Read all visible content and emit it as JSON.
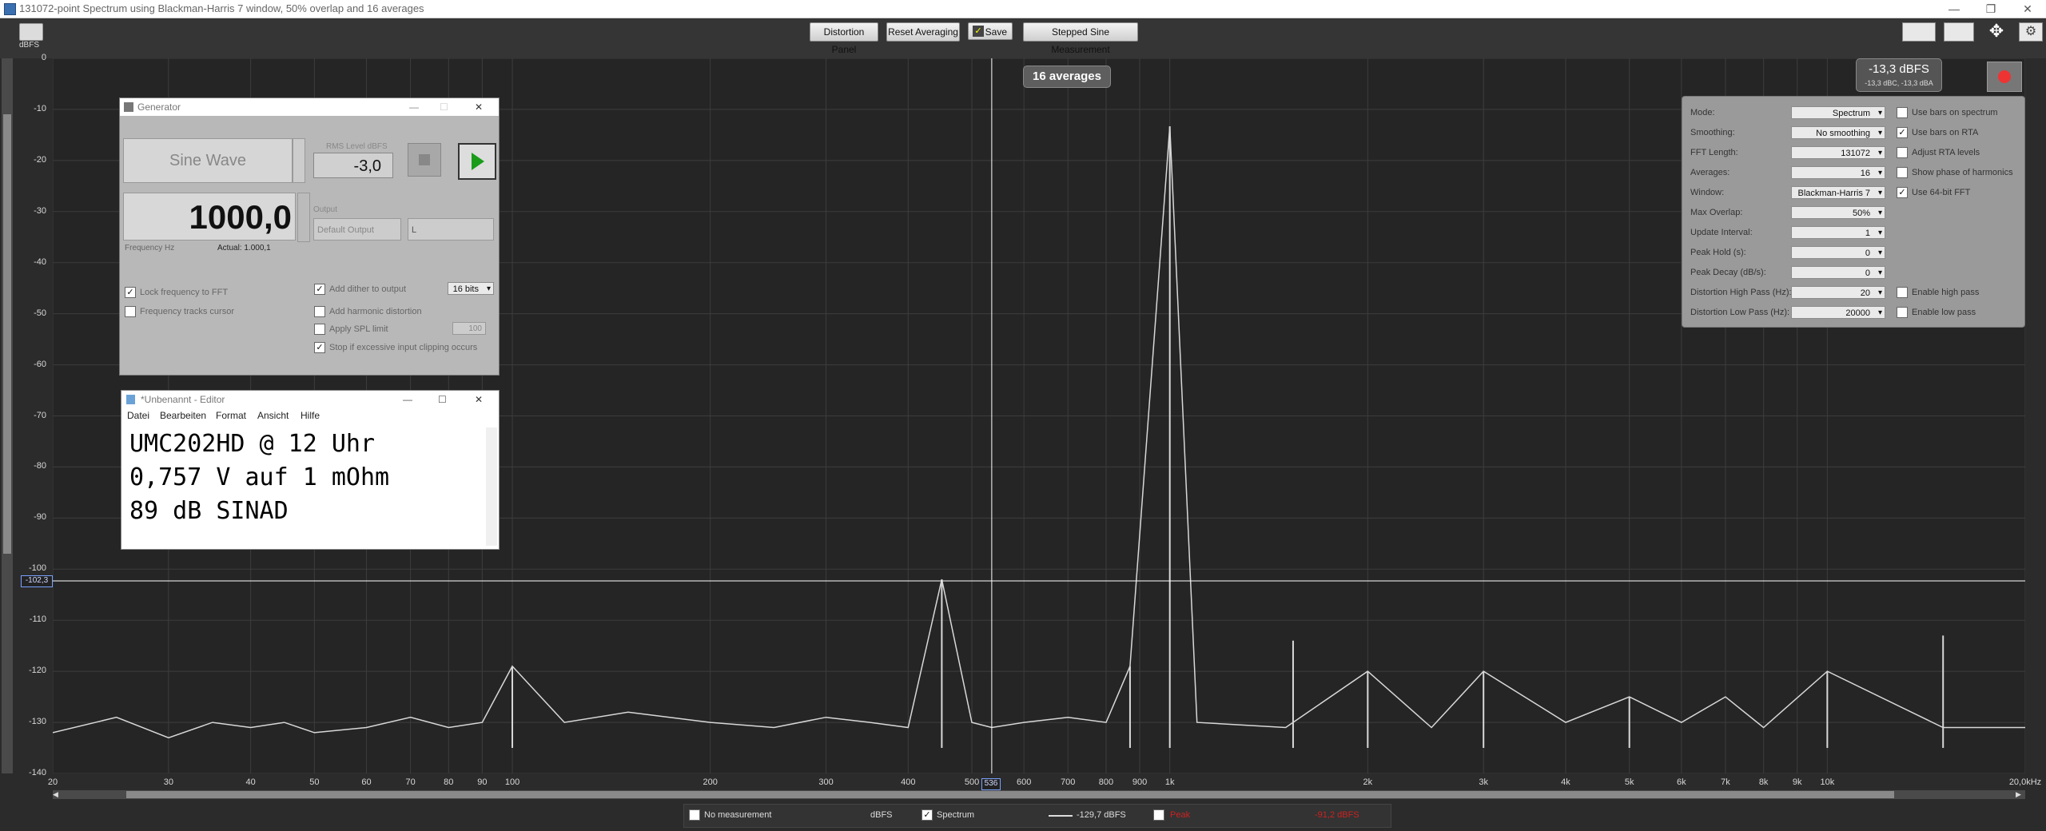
{
  "window": {
    "title": "131072-point Spectrum using Blackman-Harris 7 window, 50% overlap and 16 averages",
    "minimize": "—",
    "restore": "❐",
    "close": "✕"
  },
  "toolbar": {
    "distortion_panel": "Distortion Panel",
    "reset_averaging": "Reset Averaging",
    "save": "Save",
    "stepped_sine": "Stepped Sine Measurement"
  },
  "plot": {
    "unit_label": "dBFS",
    "averages_badge": "16 averages",
    "cursor_level": "-102,3",
    "cursor_freq": "536",
    "level_readout": "-13,3 dBFS",
    "level_sub": "-13,3 dBC, -13,3 dBA"
  },
  "chart_data": {
    "type": "line",
    "title": "",
    "xlabel": "",
    "ylabel": "dBFS",
    "xscale": "log",
    "ylim": [
      -140,
      0
    ],
    "xlim": [
      20,
      20000
    ],
    "y_ticks": [
      "0",
      "-10",
      "-20",
      "-30",
      "-40",
      "-50",
      "-60",
      "-70",
      "-80",
      "-90",
      "-100",
      "-110",
      "-120",
      "-130",
      "-140"
    ],
    "x_ticks": [
      {
        "v": 20,
        "t": "20"
      },
      {
        "v": 30,
        "t": "30"
      },
      {
        "v": 40,
        "t": "40"
      },
      {
        "v": 50,
        "t": "50"
      },
      {
        "v": 60,
        "t": "60"
      },
      {
        "v": 70,
        "t": "70"
      },
      {
        "v": 80,
        "t": "80"
      },
      {
        "v": 90,
        "t": "90"
      },
      {
        "v": 100,
        "t": "100"
      },
      {
        "v": 200,
        "t": "200"
      },
      {
        "v": 300,
        "t": "300"
      },
      {
        "v": 400,
        "t": "400"
      },
      {
        "v": 500,
        "t": "500"
      },
      {
        "v": 600,
        "t": "600"
      },
      {
        "v": 700,
        "t": "700"
      },
      {
        "v": 800,
        "t": "800"
      },
      {
        "v": 900,
        "t": "900"
      },
      {
        "v": 1000,
        "t": "1k"
      },
      {
        "v": 2000,
        "t": "2k"
      },
      {
        "v": 3000,
        "t": "3k"
      },
      {
        "v": 4000,
        "t": "4k"
      },
      {
        "v": 5000,
        "t": "5k"
      },
      {
        "v": 6000,
        "t": "6k"
      },
      {
        "v": 7000,
        "t": "7k"
      },
      {
        "v": 8000,
        "t": "8k"
      },
      {
        "v": 9000,
        "t": "9k"
      },
      {
        "v": 10000,
        "t": "10k"
      },
      {
        "v": 20000,
        "t": "20,0kHz"
      }
    ],
    "series": [
      {
        "points": [
          [
            20,
            -132
          ],
          [
            25,
            -129
          ],
          [
            30,
            -133
          ],
          [
            35,
            -130
          ],
          [
            40,
            -131
          ],
          [
            45,
            -130
          ],
          [
            50,
            -132
          ],
          [
            60,
            -131
          ],
          [
            70,
            -129
          ],
          [
            80,
            -131
          ],
          [
            90,
            -130
          ],
          [
            100,
            -119
          ],
          [
            120,
            -130
          ],
          [
            150,
            -128
          ],
          [
            200,
            -130
          ],
          [
            250,
            -131
          ],
          [
            300,
            -129
          ],
          [
            350,
            -130
          ],
          [
            400,
            -131
          ],
          [
            450,
            -102
          ],
          [
            500,
            -130
          ],
          [
            536,
            -131
          ],
          [
            600,
            -130
          ],
          [
            700,
            -129
          ],
          [
            800,
            -130
          ],
          [
            870,
            -119
          ],
          [
            1000,
            -13.3
          ],
          [
            1100,
            -130
          ],
          [
            1500,
            -131
          ],
          [
            2000,
            -120
          ],
          [
            2500,
            -131
          ],
          [
            3000,
            -120
          ],
          [
            4000,
            -130
          ],
          [
            5000,
            -125
          ],
          [
            6000,
            -130
          ],
          [
            7000,
            -125
          ],
          [
            8000,
            -131
          ],
          [
            10000,
            -120
          ],
          [
            15000,
            -131
          ],
          [
            20000,
            -131
          ]
        ]
      }
    ],
    "peaks": [
      {
        "f": 100,
        "db": -119
      },
      {
        "f": 450,
        "db": -102
      },
      {
        "f": 870,
        "db": -119
      },
      {
        "f": 1000,
        "db": -13.3
      },
      {
        "f": 1540,
        "db": -114
      },
      {
        "f": 2000,
        "db": -120
      },
      {
        "f": 3000,
        "db": -120
      },
      {
        "f": 5000,
        "db": -125
      },
      {
        "f": 10000,
        "db": -120
      },
      {
        "f": 15000,
        "db": -113
      }
    ]
  },
  "generator": {
    "title": "Generator",
    "waveform": "Sine Wave",
    "rms_label": "RMS Level dBFS",
    "rms_value": "-3,0",
    "frequency": "1000,0",
    "freq_label": "Frequency Hz",
    "actual": "Actual: 1.000,1",
    "output_label": "Output",
    "output_device": "Default Output",
    "channel": "L",
    "lock_freq": "Lock frequency to FFT",
    "freq_tracks": "Frequency tracks cursor",
    "add_dither": "Add dither to output",
    "dither_bits": "16 bits",
    "add_harmonic": "Add harmonic distortion",
    "apply_spl": "Apply SPL limit",
    "spl_value": "100",
    "stop_clipping": "Stop if excessive input clipping occurs"
  },
  "editor": {
    "title": "*Unbenannt - Editor",
    "menu": [
      "Datei",
      "Bearbeiten",
      "Format",
      "Ansicht",
      "Hilfe"
    ],
    "lines": [
      "UMC202HD @ 12 Uhr",
      "0,757 V auf 1 mOhm",
      "89 dB SINAD"
    ]
  },
  "settings": {
    "rows": [
      {
        "label": "Mode:",
        "value": "Spectrum"
      },
      {
        "label": "Smoothing:",
        "value": "No smoothing"
      },
      {
        "label": "FFT Length:",
        "value": "131072"
      },
      {
        "label": "Averages:",
        "value": "16"
      },
      {
        "label": "Window:",
        "value": "Blackman-Harris 7"
      },
      {
        "label": "Max Overlap:",
        "value": "50%"
      },
      {
        "label": "Update Interval:",
        "value": "1"
      },
      {
        "label": "Peak Hold (s):",
        "value": "0"
      },
      {
        "label": "Peak Decay (dB/s):",
        "value": "0"
      },
      {
        "label": "Distortion High Pass (Hz):",
        "value": "20"
      },
      {
        "label": "Distortion Low Pass (Hz):",
        "value": "20000"
      }
    ],
    "checks": [
      {
        "label": "Use bars on spectrum",
        "checked": false
      },
      {
        "label": "Use bars on RTA",
        "checked": true
      },
      {
        "label": "Adjust RTA levels",
        "checked": false
      },
      {
        "label": "Show phase of harmonics",
        "checked": false
      },
      {
        "label": "Use 64-bit FFT",
        "checked": true
      }
    ],
    "enable_high": "Enable high pass",
    "enable_low": "Enable low pass"
  },
  "status": {
    "no_measurement": "No measurement",
    "unit": "dBFS",
    "spectrum": "Spectrum",
    "spectrum_value": "-129,7 dBFS",
    "peak_label": "Peak",
    "peak_value": "-91,2 dBFS"
  },
  "colors": {
    "trace": "#d8d8d8",
    "grid": "#3d3d3d",
    "peak_red": "#cc2222"
  }
}
